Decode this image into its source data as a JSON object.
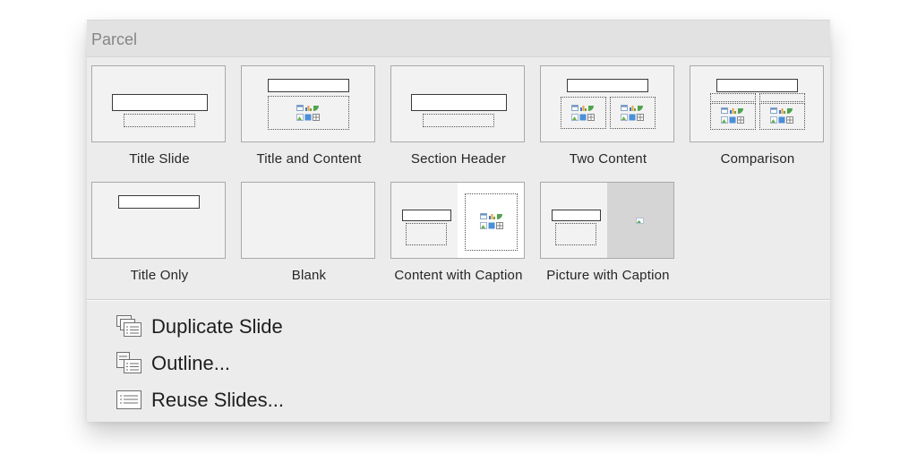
{
  "panel": {
    "title": "Parcel"
  },
  "layouts": [
    {
      "label": "Title Slide"
    },
    {
      "label": "Title and Content"
    },
    {
      "label": "Section Header"
    },
    {
      "label": "Two Content"
    },
    {
      "label": "Comparison"
    },
    {
      "label": "Title Only"
    },
    {
      "label": "Blank"
    },
    {
      "label": "Content with Caption"
    },
    {
      "label": "Picture with Caption"
    }
  ],
  "menu": {
    "duplicate_label": "Duplicate Slide",
    "outline_label": "Outline...",
    "reuse_label": "Reuse Slides..."
  },
  "icons": {
    "content_placeholder": "content-placeholder-icon",
    "picture_placeholder": "picture-placeholder-icon",
    "duplicate": "duplicate-slide-icon",
    "outline": "outline-icon",
    "reuse": "reuse-slides-icon"
  }
}
